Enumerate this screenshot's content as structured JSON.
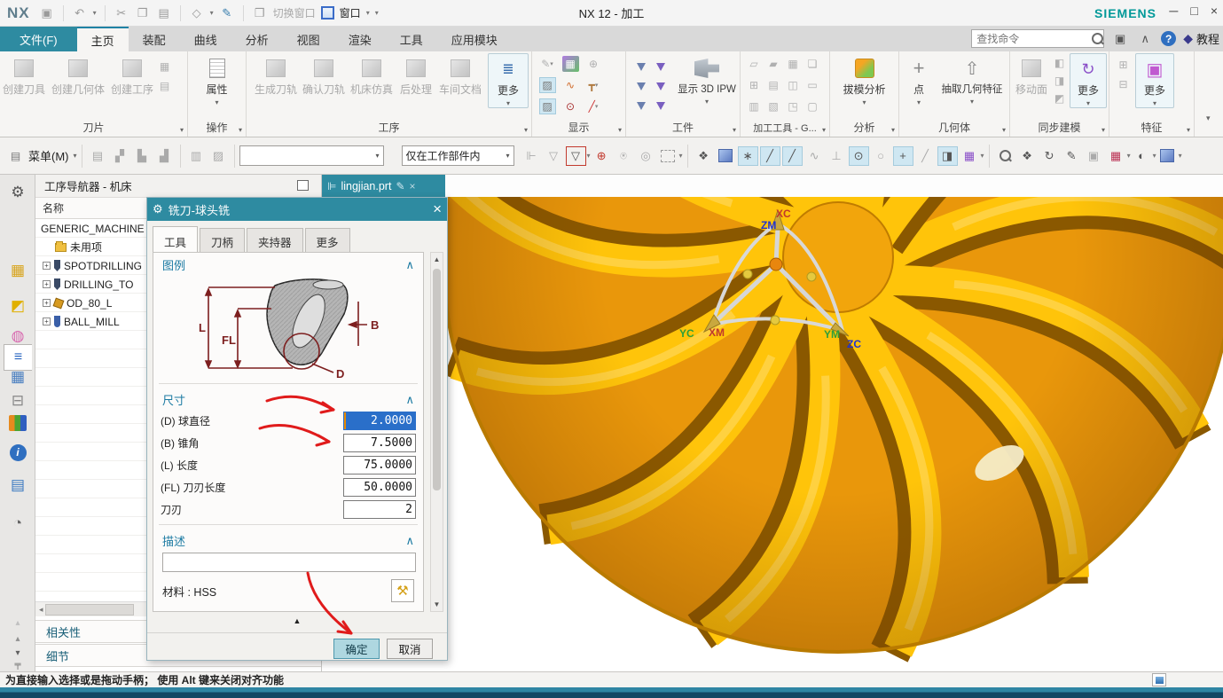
{
  "titlebar": {
    "app_logo": "NX",
    "title": "NX 12 - 加工",
    "brand": "SIEMENS",
    "switch_window_label": "切换窗口",
    "window_menu_label": "窗口"
  },
  "ribbon_tabs": {
    "file": "文件(F)",
    "tabs": [
      "主页",
      "装配",
      "曲线",
      "分析",
      "视图",
      "渲染",
      "工具",
      "应用模块"
    ],
    "active": "主页"
  },
  "topbar": {
    "find_placeholder": "查找命令",
    "tutorial_label": "教程"
  },
  "ribbon": {
    "groups": {
      "blade": {
        "label": "刀片",
        "buttons": [
          "创建刀具",
          "创建几何体",
          "创建工序"
        ]
      },
      "operation": {
        "label": "操作",
        "buttons": [
          "属性"
        ]
      },
      "process": {
        "label": "工序",
        "buttons": [
          "生成刀轨",
          "确认刀轨",
          "机床仿真",
          "后处理",
          "车间文档",
          "更多"
        ]
      },
      "display": {
        "label": "显示"
      },
      "workpiece": {
        "label": "工件",
        "buttons": [
          "显示 3D IPW"
        ]
      },
      "machining_tools": {
        "label": "加工工具 - G..."
      },
      "analysis": {
        "label": "分析",
        "buttons": [
          "拔模分析"
        ]
      },
      "geometry": {
        "label": "几何体",
        "buttons": [
          "点",
          "抽取几何特征"
        ]
      },
      "synchronous": {
        "label": "同步建模",
        "buttons": [
          "移动面",
          "更多"
        ]
      },
      "feature": {
        "label": "特征",
        "buttons": [
          "更多"
        ]
      }
    }
  },
  "toolbar2": {
    "menu_label": "菜单(M)",
    "scope_value": "仅在工作部件内"
  },
  "navigator": {
    "title": "工序导航器 - 机床",
    "column_header": "名称",
    "items": [
      {
        "label": "GENERIC_MACHINE"
      },
      {
        "label": "未用项"
      },
      {
        "label": "SPOTDRILLING"
      },
      {
        "label": "DRILLING_TO"
      },
      {
        "label": "OD_80_L"
      },
      {
        "label": "BALL_MILL"
      }
    ],
    "panels": [
      "相关性",
      "细节"
    ]
  },
  "dialog": {
    "title": "铣刀-球头铣",
    "tabs": [
      "工具",
      "刀柄",
      "夹持器",
      "更多"
    ],
    "active_tab": "工具",
    "legend": {
      "header": "图例",
      "labels": {
        "L": "L",
        "FL": "FL",
        "B": "B",
        "D": "D"
      }
    },
    "dimensions": {
      "header": "尺寸",
      "fields": [
        {
          "label": "(D) 球直径",
          "value": "2.0000"
        },
        {
          "label": "(B) 锥角",
          "value": "7.5000"
        },
        {
          "label": "(L) 长度",
          "value": "75.0000"
        },
        {
          "label": "(FL) 刀刃长度",
          "value": "50.0000"
        },
        {
          "label": "刀刃",
          "value": "2"
        }
      ]
    },
    "description": {
      "header": "描述",
      "value": "",
      "material": "材料 : HSS"
    },
    "ok_label": "确定",
    "cancel_label": "取消"
  },
  "viewport": {
    "part_tab": "lingjian.prt",
    "triad": {
      "XC": "XC",
      "ZM": "ZM",
      "YC": "YC",
      "XM": "XM",
      "YM": "YM",
      "ZC": "ZC"
    }
  },
  "statusbar": {
    "message": "为直接输入选择或是拖动手柄； 使用 Alt 键来关闭对齐功能"
  },
  "glyphs": {
    "close": "×",
    "collapse": "∧"
  },
  "colors": {
    "accent_teal": "#2e8ba1",
    "selection_blue": "#2a6fc9",
    "impeller_gold": "#ffc40a",
    "annotation_red": "#e01b1b"
  }
}
